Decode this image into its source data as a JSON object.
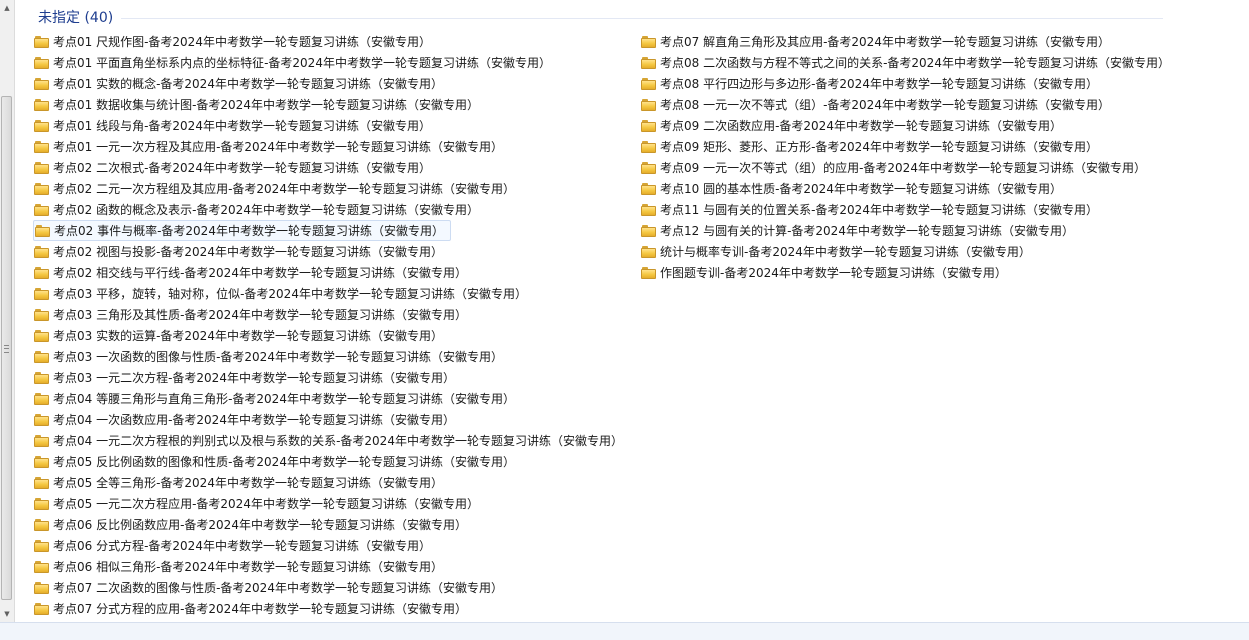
{
  "group": {
    "title": "未指定 (40)"
  },
  "column_left": [
    "考点01 尺规作图-备考2024年中考数学一轮专题复习讲练（安徽专用）",
    "考点01 平面直角坐标系内点的坐标特征-备考2024年中考数学一轮专题复习讲练（安徽专用）",
    "考点01 实数的概念-备考2024年中考数学一轮专题复习讲练（安徽专用）",
    "考点01 数据收集与统计图-备考2024年中考数学一轮专题复习讲练（安徽专用）",
    "考点01 线段与角-备考2024年中考数学一轮专题复习讲练（安徽专用）",
    "考点01 一元一次方程及其应用-备考2024年中考数学一轮专题复习讲练（安徽专用）",
    "考点02 二次根式-备考2024年中考数学一轮专题复习讲练（安徽专用）",
    "考点02 二元一次方程组及其应用-备考2024年中考数学一轮专题复习讲练（安徽专用）",
    "考点02 函数的概念及表示-备考2024年中考数学一轮专题复习讲练（安徽专用）",
    "考点02 事件与概率-备考2024年中考数学一轮专题复习讲练（安徽专用）",
    "考点02 视图与投影-备考2024年中考数学一轮专题复习讲练（安徽专用）",
    "考点02 相交线与平行线-备考2024年中考数学一轮专题复习讲练（安徽专用）",
    "考点03 平移，旋转，轴对称，位似-备考2024年中考数学一轮专题复习讲练（安徽专用）",
    "考点03 三角形及其性质-备考2024年中考数学一轮专题复习讲练（安徽专用）",
    "考点03 实数的运算-备考2024年中考数学一轮专题复习讲练（安徽专用）",
    "考点03 一次函数的图像与性质-备考2024年中考数学一轮专题复习讲练（安徽专用）",
    "考点03 一元二次方程-备考2024年中考数学一轮专题复习讲练（安徽专用）",
    "考点04 等腰三角形与直角三角形-备考2024年中考数学一轮专题复习讲练（安徽专用）",
    "考点04 一次函数应用-备考2024年中考数学一轮专题复习讲练（安徽专用）",
    "考点04 一元二次方程根的判别式以及根与系数的关系-备考2024年中考数学一轮专题复习讲练（安徽专用）",
    "考点05 反比例函数的图像和性质-备考2024年中考数学一轮专题复习讲练（安徽专用）",
    "考点05 全等三角形-备考2024年中考数学一轮专题复习讲练（安徽专用）",
    "考点05 一元二次方程应用-备考2024年中考数学一轮专题复习讲练（安徽专用）",
    "考点06 反比例函数应用-备考2024年中考数学一轮专题复习讲练（安徽专用）",
    "考点06 分式方程-备考2024年中考数学一轮专题复习讲练（安徽专用）",
    "考点06 相似三角形-备考2024年中考数学一轮专题复习讲练（安徽专用）",
    "考点07 二次函数的图像与性质-备考2024年中考数学一轮专题复习讲练（安徽专用）",
    "考点07 分式方程的应用-备考2024年中考数学一轮专题复习讲练（安徽专用）"
  ],
  "column_right": [
    "考点07 解直角三角形及其应用-备考2024年中考数学一轮专题复习讲练（安徽专用）",
    "考点08 二次函数与方程不等式之间的关系-备考2024年中考数学一轮专题复习讲练（安徽专用）",
    "考点08 平行四边形与多边形-备考2024年中考数学一轮专题复习讲练（安徽专用）",
    "考点08 一元一次不等式（组）-备考2024年中考数学一轮专题复习讲练（安徽专用）",
    "考点09 二次函数应用-备考2024年中考数学一轮专题复习讲练（安徽专用）",
    "考点09 矩形、菱形、正方形-备考2024年中考数学一轮专题复习讲练（安徽专用）",
    "考点09 一元一次不等式（组）的应用-备考2024年中考数学一轮专题复习讲练（安徽专用）",
    "考点10 圆的基本性质-备考2024年中考数学一轮专题复习讲练（安徽专用）",
    "考点11 与圆有关的位置关系-备考2024年中考数学一轮专题复习讲练（安徽专用）",
    "考点12 与圆有关的计算-备考2024年中考数学一轮专题复习讲练（安徽专用）",
    "统计与概率专训-备考2024年中考数学一轮专题复习讲练（安徽专用）",
    "作图题专训-备考2024年中考数学一轮专题复习讲练（安徽专用）"
  ],
  "selected_index": 9,
  "colors": {
    "group_title": "#1e3d8f",
    "folder": "#f5c842",
    "selection_bg": "#f4f9ff",
    "selection_border": "#cddcf2"
  },
  "icons": {
    "item": "folder-icon"
  }
}
